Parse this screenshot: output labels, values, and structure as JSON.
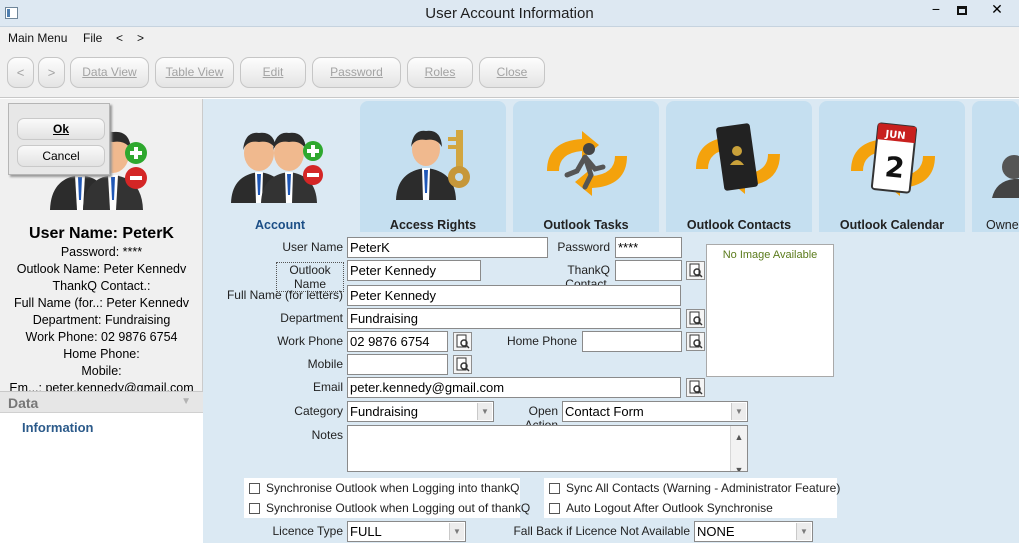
{
  "window": {
    "title": "User Account Information",
    "min": "−",
    "close": "✕"
  },
  "menu": [
    "Main Menu",
    "File",
    "<",
    ">"
  ],
  "toolbar": {
    "back": "<",
    "forward": ">",
    "data_view": "Data View",
    "table_view": "Table View",
    "edit": "Edit",
    "password": "Password",
    "roles": "Roles",
    "close": "Close"
  },
  "dialog": {
    "ok": "Ok",
    "cancel": "Cancel"
  },
  "summary": {
    "title": "User Name: PeterK",
    "lines": [
      "Password: ****",
      "Outlook Name: Peter Kennedv",
      "ThankQ Contact.:",
      "Full Name (for..: Peter Kennedv",
      "Department: Fundraising",
      "Work Phone: 02 9876 6754",
      "Home Phone:",
      "Mobile:",
      "Em...: peter.kennedy@gmail.com"
    ]
  },
  "nav": {
    "header": "Data",
    "chevron": "▼",
    "items": [
      "Information"
    ]
  },
  "tabs": [
    "Account",
    "Access Rights",
    "Outlook Tasks",
    "Outlook Contacts",
    "Outlook Calendar",
    "Owne"
  ],
  "form": {
    "user_name_label": "User Name",
    "user_name": "PeterK",
    "password_label": "Password",
    "password": "****",
    "outlook_name_label": "Outlook Name",
    "outlook_name": "Peter Kennedy",
    "thankq_label": "ThankQ Contact.",
    "thankq": "",
    "full_name_label": "Full Name (for letters)",
    "full_name": "Peter Kennedy",
    "department_label": "Department",
    "department": "Fundraising",
    "work_phone_label": "Work Phone",
    "work_phone": "02 9876 6754",
    "home_phone_label": "Home Phone",
    "home_phone": "",
    "mobile_label": "Mobile",
    "mobile": "",
    "email_label": "Email",
    "email": "peter.kennedy@gmail.com",
    "category_label": "Category",
    "category": "Fundraising",
    "open_action_label": "Open Action",
    "open_action": "Contact Form",
    "notes_label": "Notes",
    "notes": "",
    "licence_type_label": "Licence Type",
    "licence_type": "FULL",
    "fallback_label": "Fall Back if Licence Not Available",
    "fallback": "NONE",
    "no_image": "No Image Available"
  },
  "checks": {
    "sync_login": "Synchronise Outlook when Logging into thankQ",
    "sync_logout": "Synchronise Outlook when Logging out of thankQ",
    "sync_all": "Sync All Contacts (Warning - Administrator Feature)",
    "auto_logout": "Auto Logout After Outlook Synchronise"
  }
}
